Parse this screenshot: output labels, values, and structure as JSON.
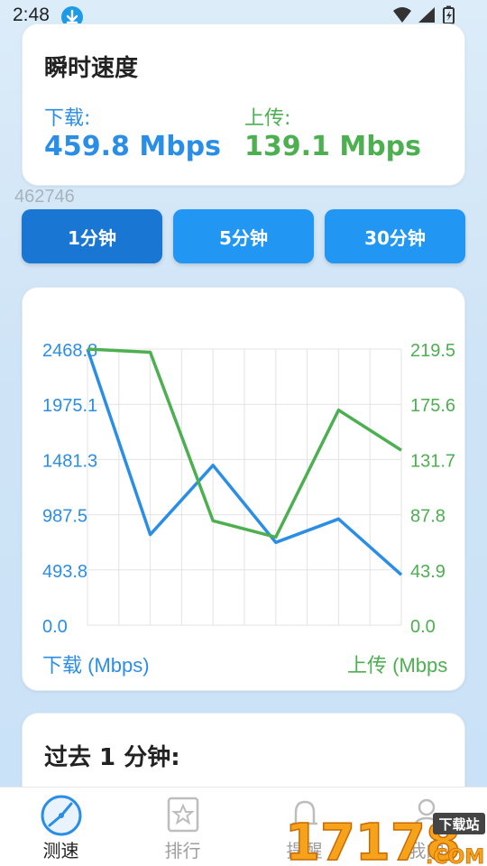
{
  "status_bar": {
    "time": "2:48"
  },
  "speed_card": {
    "title": "瞬时速度",
    "download_label": "下载:",
    "download_value": "459.8 Mbps",
    "upload_label": "上传:",
    "upload_value": "139.1 Mbps"
  },
  "id_text": "462746",
  "range_buttons": [
    {
      "label": "1分钟",
      "active": true
    },
    {
      "label": "5分钟",
      "active": false
    },
    {
      "label": "30分钟",
      "active": false
    }
  ],
  "chart_data": {
    "type": "line",
    "left_axis": {
      "label": "下载 (Mbps)",
      "ticks": [
        "0.0",
        "493.8",
        "987.5",
        "1481.3",
        "1975.1",
        "2468.8"
      ],
      "range": [
        0,
        2468.8
      ]
    },
    "right_axis": {
      "label": "上传 (Mbps",
      "ticks": [
        "0.0",
        "43.9",
        "87.8",
        "131.7",
        "175.6",
        "219.5"
      ],
      "range": [
        0,
        219.5
      ]
    },
    "x": [
      0,
      1,
      2,
      3,
      4,
      5
    ],
    "series": [
      {
        "name": "下载 (Mbps)",
        "axis": "left",
        "color": "#2b8ee6",
        "values": [
          2468.8,
          810,
          1430,
          740,
          950,
          450
        ]
      },
      {
        "name": "上传 (Mbps",
        "axis": "right",
        "color": "#4caf50",
        "values": [
          219.5,
          217.0,
          83.0,
          70.0,
          171.0,
          139.1
        ]
      }
    ],
    "grid": true
  },
  "history": {
    "title": "过去 1 分钟:"
  },
  "nav": {
    "items": [
      {
        "label": "测速",
        "icon": "speedometer-icon",
        "active": true
      },
      {
        "label": "排行",
        "icon": "ranking-star-icon",
        "active": false
      },
      {
        "label": "提醒",
        "icon": "bell-icon",
        "active": false
      },
      {
        "label": "我的",
        "icon": "person-icon",
        "active": false
      }
    ]
  },
  "watermark": {
    "text": "17178",
    "sub": ".COM",
    "badge": "下载站"
  },
  "colors": {
    "download": "#2b8ee6",
    "upload": "#4caf50",
    "button": "#2196f3",
    "button_active": "#1976d2"
  }
}
